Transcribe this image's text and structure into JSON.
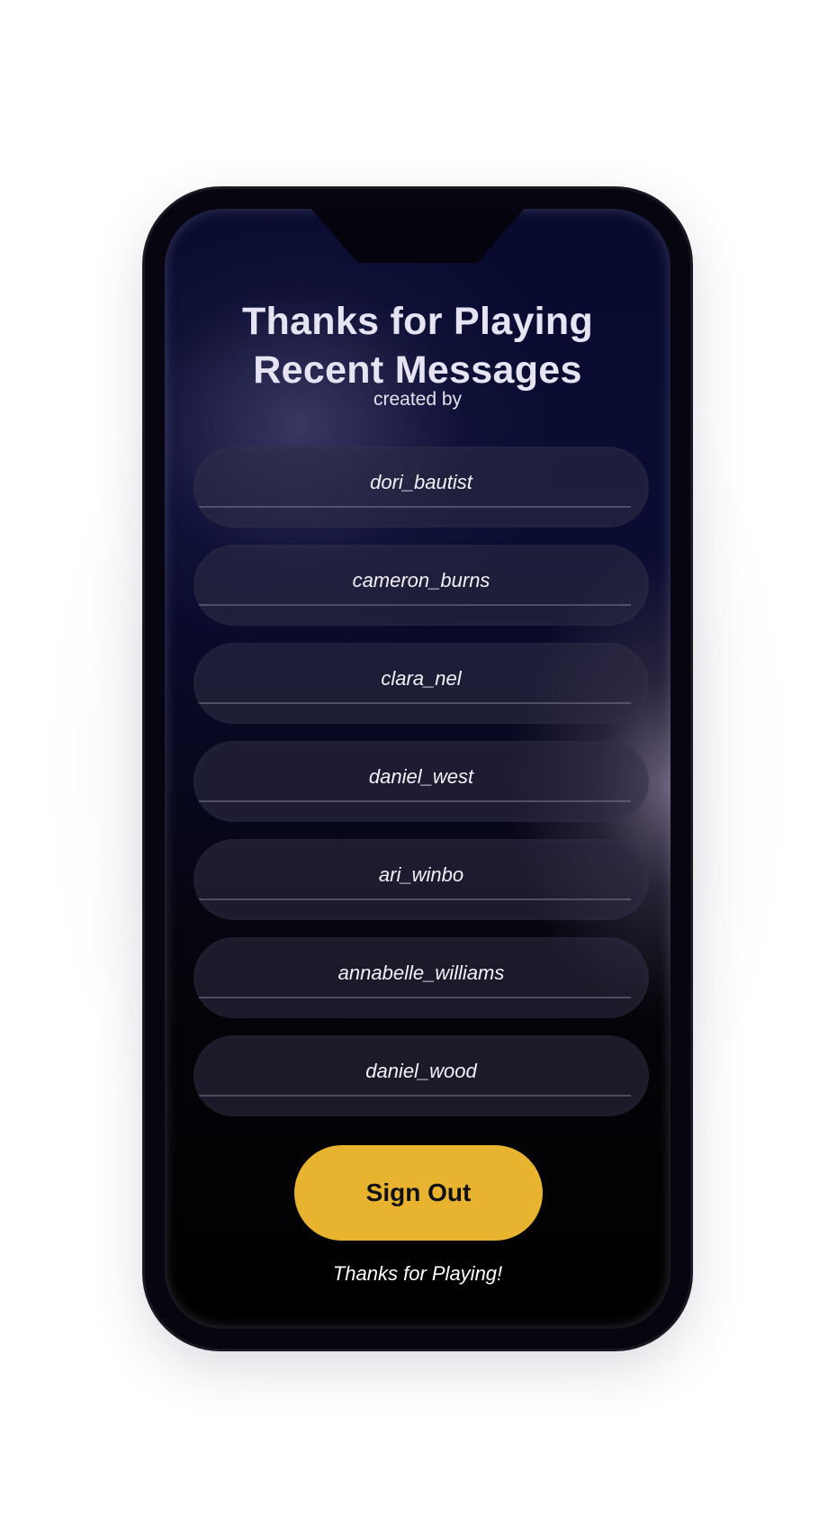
{
  "header": {
    "title_line1": "Thanks for Playing",
    "title_line2": "Recent Messages",
    "subtitle": "created by"
  },
  "messages": [
    {
      "label": "dori_bautist"
    },
    {
      "label": "cameron_burns"
    },
    {
      "label": "clara_nel"
    },
    {
      "label": "daniel_west"
    },
    {
      "label": "ari_winbo"
    },
    {
      "label": "annabelle_williams"
    },
    {
      "label": "daniel_wood"
    }
  ],
  "actions": {
    "sign_out_label": "Sign Out"
  },
  "footer": {
    "text": "Thanks for Playing!"
  },
  "colors": {
    "accent": "#e8b42f",
    "screen_top": "#0a0c33",
    "screen_bottom": "#000000"
  }
}
